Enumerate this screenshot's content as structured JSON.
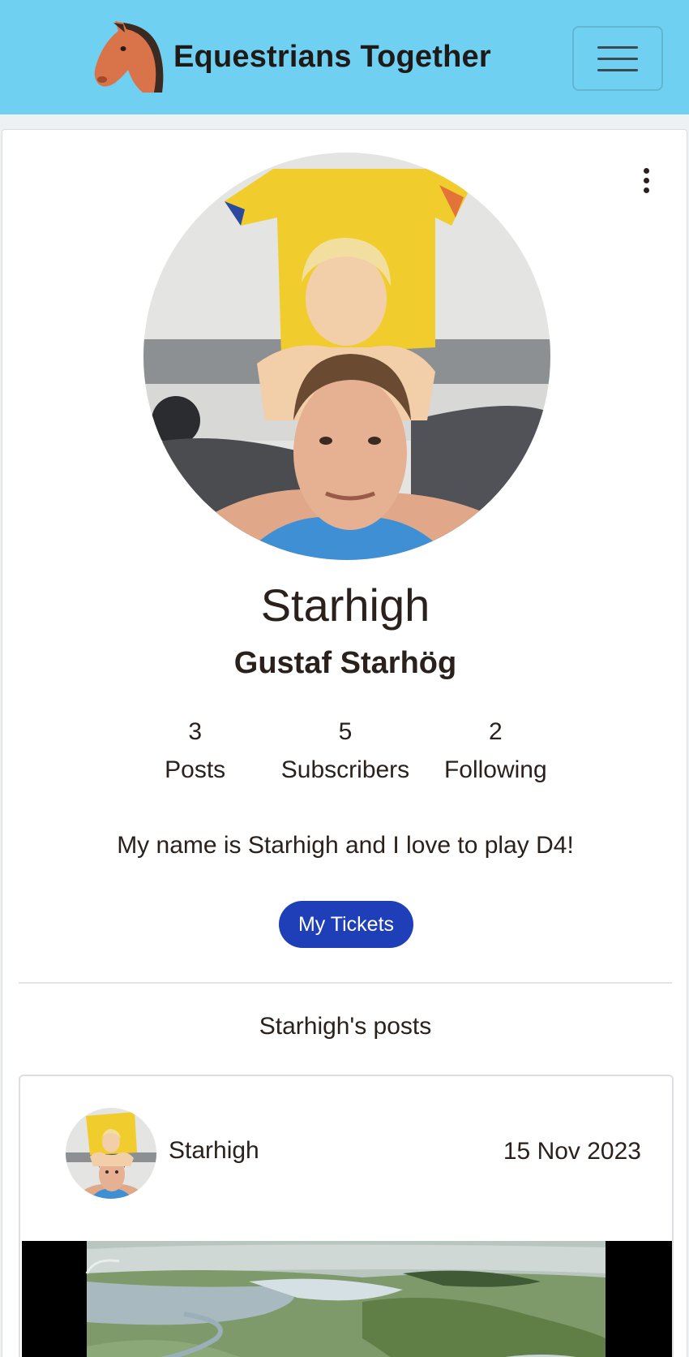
{
  "navbar": {
    "brand_name": "Equestrians Together",
    "logo_icon": "horse-head-icon",
    "menu_icon": "hamburger-menu-icon"
  },
  "profile": {
    "menu_icon": "kebab-menu-icon",
    "username": "Starhigh",
    "full_name": "Gustaf Starhög",
    "stats": [
      {
        "value": "3",
        "label": "Posts"
      },
      {
        "value": "5",
        "label": "Subscribers"
      },
      {
        "value": "2",
        "label": "Following"
      }
    ],
    "bio": "My name is Starhigh and I love to play D4!",
    "tickets_button": "My Tickets"
  },
  "posts_section": {
    "heading": "Starhigh's posts",
    "posts": [
      {
        "author": "Starhigh",
        "date": "15 Nov 2023"
      }
    ]
  },
  "colors": {
    "navbar_bg": "#6fd0f2",
    "button_primary": "#1e3fb8",
    "text": "#2a211c"
  }
}
